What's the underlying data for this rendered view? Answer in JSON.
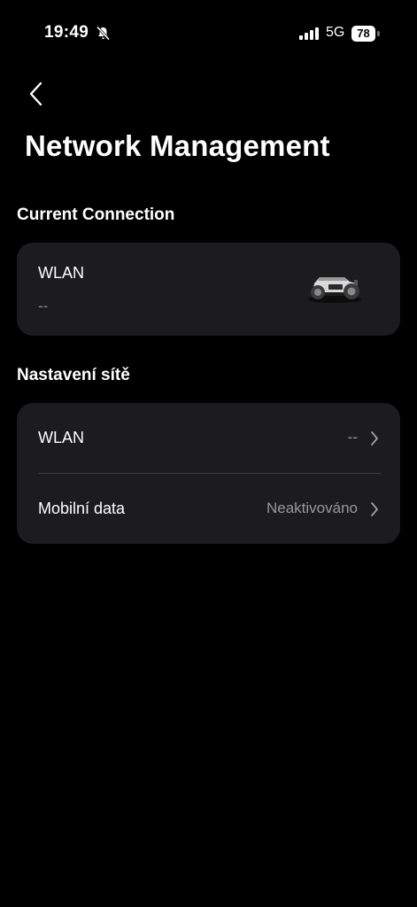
{
  "status_bar": {
    "time": "19:49",
    "network": "5G",
    "battery": "78",
    "bell_icon": "bell-muted-icon",
    "signal_icon": "cellular-signal-icon"
  },
  "header": {
    "back_icon": "chevron-left-icon",
    "title": "Network Management"
  },
  "current_connection": {
    "section_title": "Current Connection",
    "label": "WLAN",
    "value": "--",
    "device_icon": "robot-mower-image"
  },
  "network_settings": {
    "section_title": "Nastavení sítě",
    "rows": [
      {
        "label": "WLAN",
        "value": "--",
        "icon": "chevron-right-icon"
      },
      {
        "label": "Mobilní data",
        "value": "Neaktivováno",
        "icon": "chevron-right-icon"
      }
    ]
  },
  "colors": {
    "background": "#000000",
    "card": "#1c1c1e",
    "text": "#ffffff",
    "secondary_text": "#98989d",
    "divider": "#3a3a3c"
  }
}
